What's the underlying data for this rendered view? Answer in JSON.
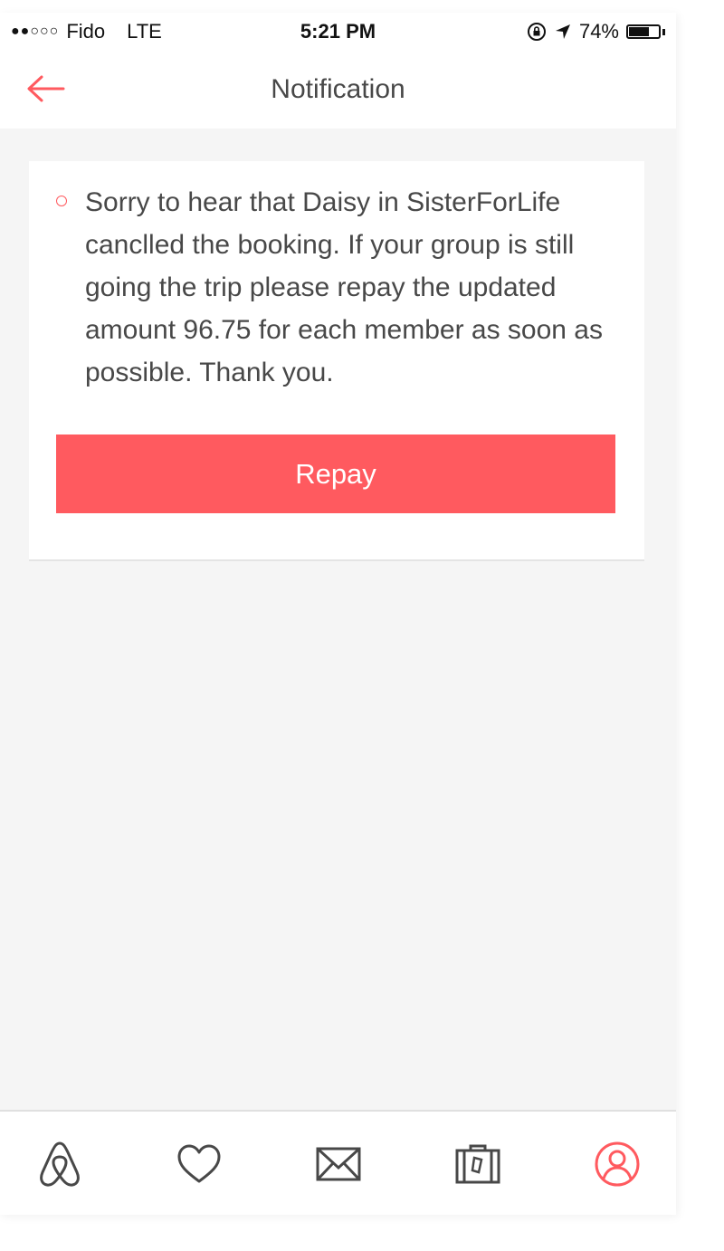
{
  "status_bar": {
    "signal_dots": "●●○○○",
    "carrier": "Fido",
    "network": "LTE",
    "time": "5:21 PM",
    "battery_percent_label": "74%",
    "battery_level": 0.74
  },
  "header": {
    "title": "Notification",
    "back_icon": "arrow-left-icon"
  },
  "notification": {
    "message": "Sorry to hear that Daisy in SisterForLife canclled the booking. If your group is still going the trip please repay the updated amount 96.75 for each member as soon as possible. Thank you.",
    "action_label": "Repay"
  },
  "tab_bar": {
    "items": [
      {
        "icon": "airbnb-logo-icon",
        "active": false
      },
      {
        "icon": "heart-icon",
        "active": false
      },
      {
        "icon": "envelope-icon",
        "active": false
      },
      {
        "icon": "suitcase-icon",
        "active": false
      },
      {
        "icon": "profile-icon",
        "active": true
      }
    ]
  },
  "colors": {
    "accent": "#ff5a5f",
    "text": "#484848",
    "background": "#f5f5f5",
    "icon": "#484848"
  }
}
